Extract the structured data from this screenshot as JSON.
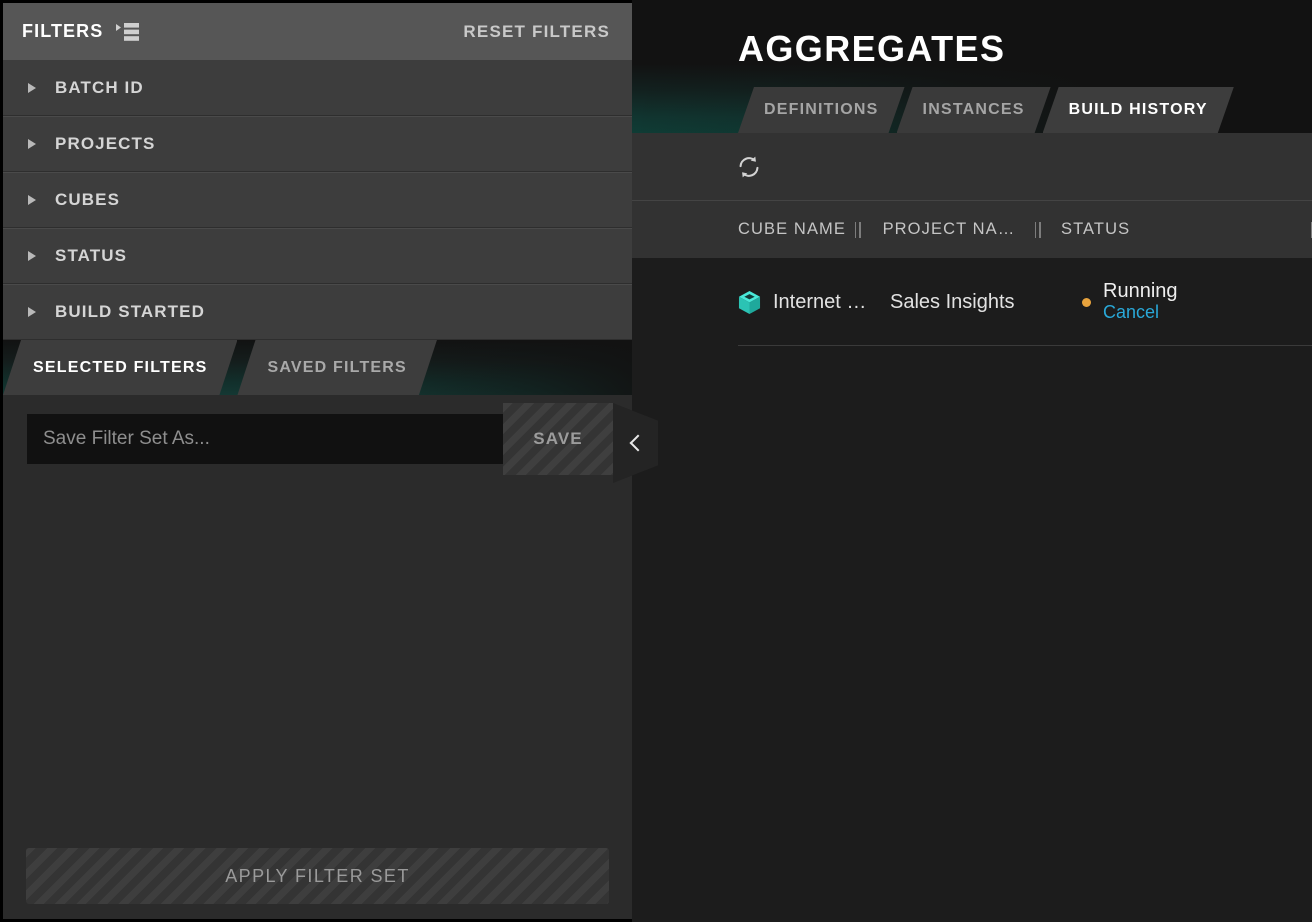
{
  "sidebar": {
    "header": {
      "title": "FILTERS",
      "icon": "filter-list-icon",
      "reset_label": "RESET FILTERS"
    },
    "sections": [
      {
        "label": "BATCH ID",
        "icon": "triangle-right-icon",
        "expanded": false
      },
      {
        "label": "PROJECTS",
        "icon": "triangle-right-icon",
        "expanded": false
      },
      {
        "label": "CUBES",
        "icon": "triangle-right-icon",
        "expanded": false
      },
      {
        "label": "STATUS",
        "icon": "triangle-right-icon",
        "expanded": false
      },
      {
        "label": "BUILD STARTED",
        "icon": "triangle-right-icon",
        "expanded": false
      }
    ],
    "tabs": [
      {
        "label": "SELECTED FILTERS",
        "active": true
      },
      {
        "label": "SAVED FILTERS",
        "active": false
      }
    ],
    "save_row": {
      "input_value": "",
      "input_placeholder": "Save Filter Set As...",
      "save_label": "SAVE",
      "save_enabled": false,
      "collapse_icon": "chevron-left-icon"
    },
    "footer": {
      "apply_label": "APPLY FILTER SET",
      "apply_enabled": false
    }
  },
  "main": {
    "title": "AGGREGATES",
    "tabs": [
      {
        "label": "DEFINITIONS",
        "active": false
      },
      {
        "label": "INSTANCES",
        "active": false
      },
      {
        "label": "BUILD HISTORY",
        "active": true
      }
    ],
    "toolbar": {
      "refresh_icon": "refresh-icon"
    },
    "table": {
      "columns": [
        {
          "label": "CUBE NAME"
        },
        {
          "label": "PROJECT NA…"
        },
        {
          "label": "STATUS"
        }
      ],
      "rows": [
        {
          "cube_icon": "cube-icon",
          "cube_name": "Internet …",
          "project_name": "Sales Insights",
          "status": "Running",
          "status_dot_color": "#e8a33d",
          "action_label": "Cancel"
        }
      ]
    }
  },
  "colors": {
    "accent_teal": "#2ed6c8",
    "link_blue": "#29a8d8",
    "status_orange": "#e8a33d",
    "panel_dark": "#1a1a1a",
    "sidebar_gray": "#3d3d3d",
    "header_gray": "#565656"
  }
}
